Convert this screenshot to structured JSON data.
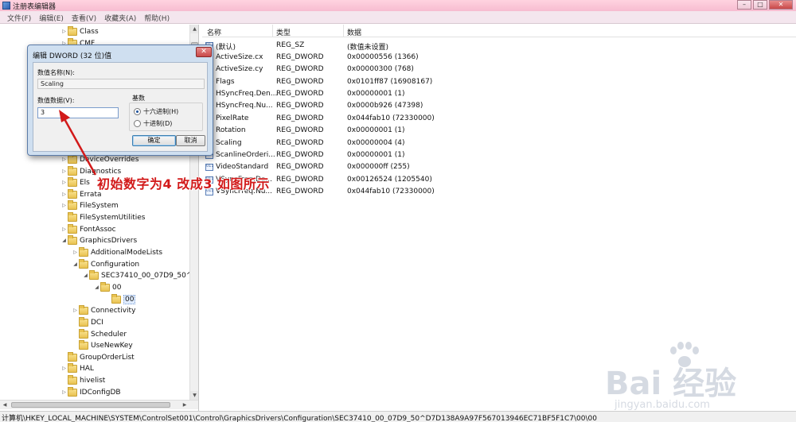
{
  "window": {
    "title": "注册表编辑器",
    "buttons": {
      "minimize": "–",
      "maximize": "□",
      "close": "✕"
    }
  },
  "menu": [
    "文件(F)",
    "编辑(E)",
    "查看(V)",
    "收藏夹(A)",
    "帮助(H)"
  ],
  "tree": {
    "items": [
      {
        "label": "Class",
        "expander": "▷"
      },
      {
        "label": "CMF",
        "expander": "▷"
      },
      {
        "label": "DeviceOverrides",
        "expander": "▷"
      },
      {
        "label": "Diagnostics",
        "expander": "▷"
      },
      {
        "label": "Els",
        "expander": "▷"
      },
      {
        "label": "Errata",
        "expander": "▷"
      },
      {
        "label": "FileSystem",
        "expander": "▷"
      },
      {
        "label": "FileSystemUtilities",
        "expander": ""
      },
      {
        "label": "FontAssoc",
        "expander": "▷"
      },
      {
        "label": "GraphicsDrivers",
        "expander": "◢"
      },
      {
        "label": "AdditionalModeLists",
        "expander": "▷"
      },
      {
        "label": "Configuration",
        "expander": "◢"
      },
      {
        "label": "SEC37410_00_07D9_50^D",
        "expander": "◢"
      },
      {
        "label": "00",
        "expander": "◢"
      },
      {
        "label": "00",
        "expander": ""
      },
      {
        "label": "Connectivity",
        "expander": "▷"
      },
      {
        "label": "DCI",
        "expander": ""
      },
      {
        "label": "Scheduler",
        "expander": ""
      },
      {
        "label": "UseNewKey",
        "expander": ""
      },
      {
        "label": "GroupOrderList",
        "expander": ""
      },
      {
        "label": "HAL",
        "expander": "▷"
      },
      {
        "label": "hivelist",
        "expander": ""
      },
      {
        "label": "IDConfigDB",
        "expander": "▷"
      }
    ],
    "scroll": {
      "up": "▲",
      "down": "▼",
      "left": "◀",
      "right": "▶"
    }
  },
  "list": {
    "headers": {
      "name": "名称",
      "type": "类型",
      "data": "数据"
    },
    "rows": [
      {
        "name": "(默认)",
        "type": "REG_SZ",
        "data": "(数值未设置)"
      },
      {
        "name": "ActiveSize.cx",
        "type": "REG_DWORD",
        "data": "0x00000556 (1366)"
      },
      {
        "name": "ActiveSize.cy",
        "type": "REG_DWORD",
        "data": "0x00000300 (768)"
      },
      {
        "name": "Flags",
        "type": "REG_DWORD",
        "data": "0x0101ff87 (16908167)"
      },
      {
        "name": "HSyncFreq.Den...",
        "type": "REG_DWORD",
        "data": "0x00000001 (1)"
      },
      {
        "name": "HSyncFreq.Nu...",
        "type": "REG_DWORD",
        "data": "0x0000b926 (47398)"
      },
      {
        "name": "PixelRate",
        "type": "REG_DWORD",
        "data": "0x044fab10 (72330000)"
      },
      {
        "name": "Rotation",
        "type": "REG_DWORD",
        "data": "0x00000001 (1)"
      },
      {
        "name": "Scaling",
        "type": "REG_DWORD",
        "data": "0x00000004 (4)"
      },
      {
        "name": "ScanlineOrderi...",
        "type": "REG_DWORD",
        "data": "0x00000001 (1)"
      },
      {
        "name": "VideoStandard",
        "type": "REG_DWORD",
        "data": "0x000000ff (255)"
      },
      {
        "name": "VSyncFreq.De...",
        "type": "REG_DWORD",
        "data": "0x00126524 (1205540)"
      },
      {
        "name": "VSyncFreq.Nu...",
        "type": "REG_DWORD",
        "data": "0x044fab10 (72330000)"
      }
    ]
  },
  "status": {
    "path": "计算机\\HKEY_LOCAL_MACHINE\\SYSTEM\\ControlSet001\\Control\\GraphicsDrivers\\Configuration\\SEC37410_00_07D9_50^D7D138A9A97F567013946EC71BF5F1C7\\00\\00"
  },
  "dialog": {
    "title": "编辑 DWORD (32 位)值",
    "close": "✕",
    "name_label": "数值名称(N):",
    "name_value": "Scaling",
    "data_label": "数值数据(V):",
    "data_value": "3",
    "radix_label": "基数",
    "radix_hex": "十六进制(H)",
    "radix_dec": "十进制(D)",
    "radix_selected": "hex",
    "ok": "确定",
    "cancel": "取消"
  },
  "annotation": {
    "text": "初始数字为4 改成3 如图所示",
    "color": "#d21a1a"
  },
  "watermark": {
    "logo": "Bai 经验",
    "url": "jingyan.baidu.com"
  }
}
